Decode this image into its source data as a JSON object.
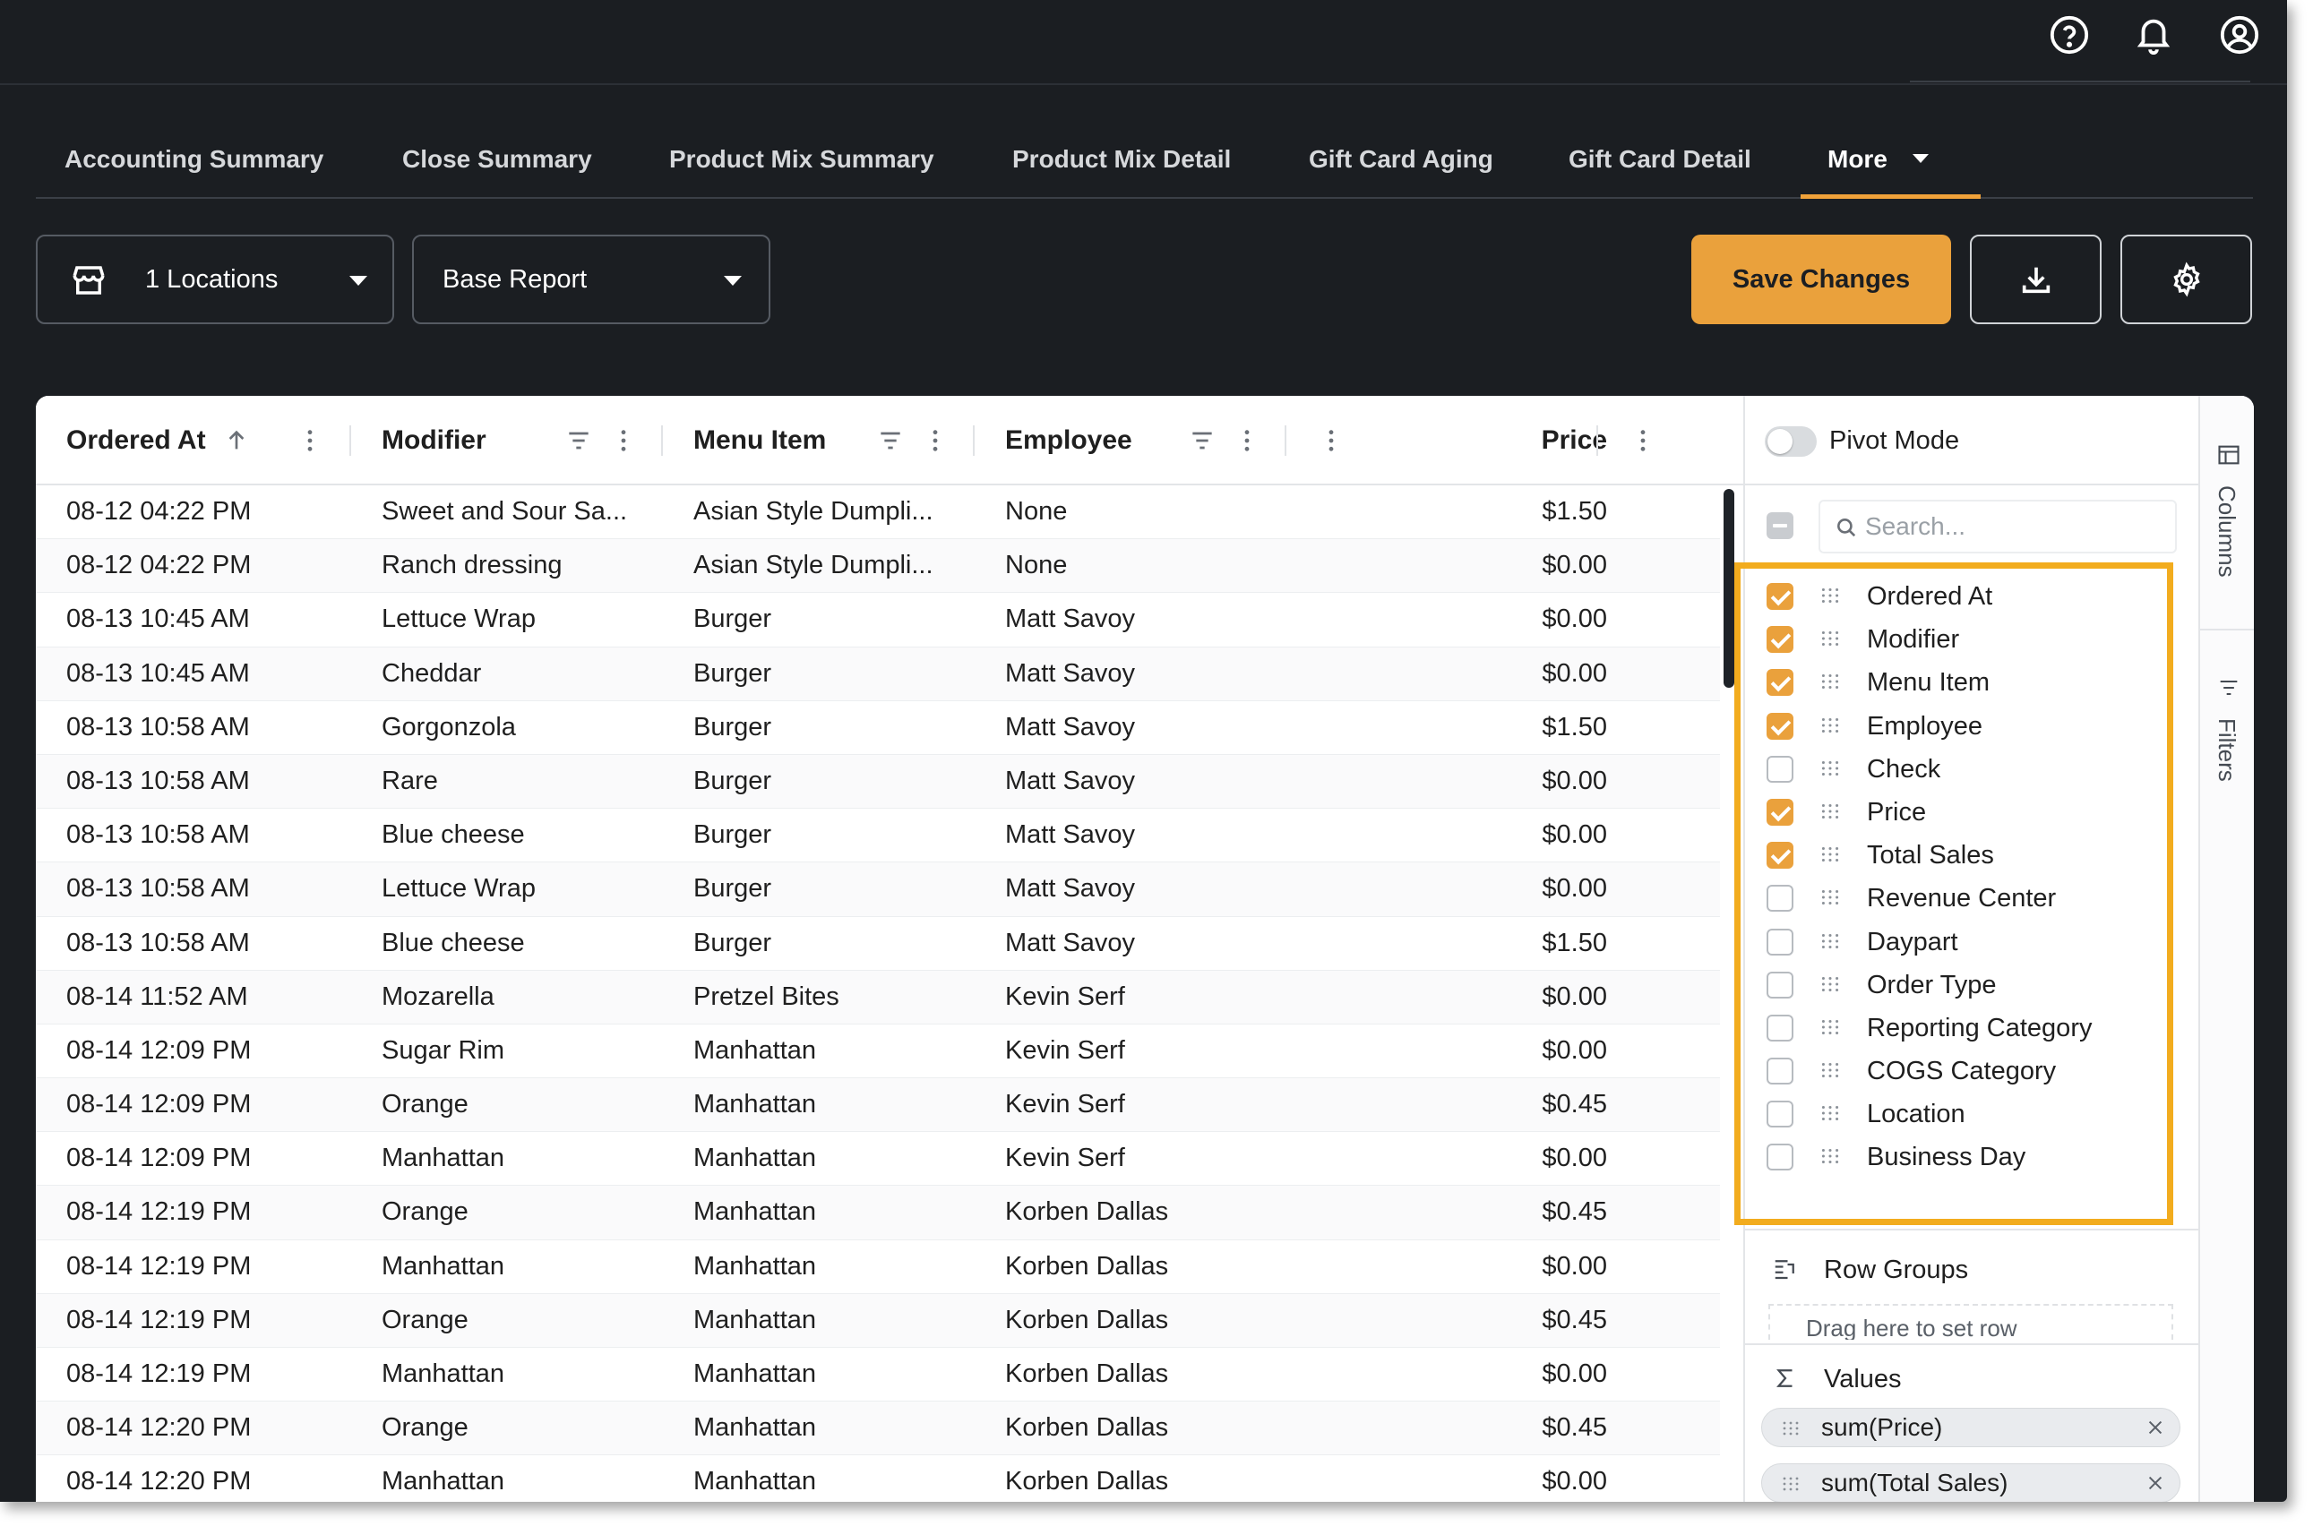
{
  "topbar": {
    "icons": [
      "help-icon",
      "bell-icon",
      "account-icon"
    ]
  },
  "tabs": [
    {
      "label": "Accounting Summary"
    },
    {
      "label": "Close Summary"
    },
    {
      "label": "Product Mix Summary"
    },
    {
      "label": "Product Mix Detail"
    },
    {
      "label": "Gift Card Aging"
    },
    {
      "label": "Gift Card Detail"
    },
    {
      "label": "More",
      "active": true
    }
  ],
  "toolbar": {
    "locations_label": "1 Locations",
    "report_label": "Base Report",
    "save_label": "Save Changes",
    "accent_color": "#eaa13c"
  },
  "grid": {
    "columns": [
      {
        "label": "Ordered At",
        "sort": "ascending"
      },
      {
        "label": "Modifier"
      },
      {
        "label": "Menu Item"
      },
      {
        "label": "Employee"
      },
      {
        "label": ""
      },
      {
        "label": "Price"
      }
    ],
    "rows": [
      [
        "08-12 04:22 PM",
        "Sweet and Sour Sa...",
        "Asian Style Dumpli...",
        "None",
        "$1.50"
      ],
      [
        "08-12 04:22 PM",
        "Ranch dressing",
        "Asian Style Dumpli...",
        "None",
        "$0.00"
      ],
      [
        "08-13 10:45 AM",
        "Lettuce Wrap",
        "Burger",
        "Matt Savoy",
        "$0.00"
      ],
      [
        "08-13 10:45 AM",
        "Cheddar",
        "Burger",
        "Matt Savoy",
        "$0.00"
      ],
      [
        "08-13 10:58 AM",
        "Gorgonzola",
        "Burger",
        "Matt Savoy",
        "$1.50"
      ],
      [
        "08-13 10:58 AM",
        "Rare",
        "Burger",
        "Matt Savoy",
        "$0.00"
      ],
      [
        "08-13 10:58 AM",
        "Blue cheese",
        "Burger",
        "Matt Savoy",
        "$0.00"
      ],
      [
        "08-13 10:58 AM",
        "Lettuce Wrap",
        "Burger",
        "Matt Savoy",
        "$0.00"
      ],
      [
        "08-13 10:58 AM",
        "Blue cheese",
        "Burger",
        "Matt Savoy",
        "$1.50"
      ],
      [
        "08-14 11:52 AM",
        "Mozarella",
        "Pretzel Bites",
        "Kevin Serf",
        "$0.00"
      ],
      [
        "08-14 12:09 PM",
        "Sugar Rim",
        "Manhattan",
        "Kevin Serf",
        "$0.00"
      ],
      [
        "08-14 12:09 PM",
        "Orange",
        "Manhattan",
        "Kevin Serf",
        "$0.45"
      ],
      [
        "08-14 12:09 PM",
        "Manhattan",
        "Manhattan",
        "Kevin Serf",
        "$0.00"
      ],
      [
        "08-14 12:19 PM",
        "Orange",
        "Manhattan",
        "Korben Dallas",
        "$0.45"
      ],
      [
        "08-14 12:19 PM",
        "Manhattan",
        "Manhattan",
        "Korben Dallas",
        "$0.00"
      ],
      [
        "08-14 12:19 PM",
        "Orange",
        "Manhattan",
        "Korben Dallas",
        "$0.45"
      ],
      [
        "08-14 12:19 PM",
        "Manhattan",
        "Manhattan",
        "Korben Dallas",
        "$0.00"
      ],
      [
        "08-14 12:20 PM",
        "Orange",
        "Manhattan",
        "Korben Dallas",
        "$0.45"
      ],
      [
        "08-14 12:20 PM",
        "Manhattan",
        "Manhattan",
        "Korben Dallas",
        "$0.00"
      ]
    ]
  },
  "side_panel": {
    "pivot_label": "Pivot Mode",
    "pivot_on": false,
    "search_placeholder": "Search...",
    "columns": [
      {
        "label": "Ordered At",
        "checked": true
      },
      {
        "label": "Modifier",
        "checked": true
      },
      {
        "label": "Menu Item",
        "checked": true
      },
      {
        "label": "Employee",
        "checked": true
      },
      {
        "label": "Check",
        "checked": false
      },
      {
        "label": "Price",
        "checked": true
      },
      {
        "label": "Total Sales",
        "checked": true
      },
      {
        "label": "Revenue Center",
        "checked": false
      },
      {
        "label": "Daypart",
        "checked": false
      },
      {
        "label": "Order Type",
        "checked": false
      },
      {
        "label": "Reporting Category",
        "checked": false
      },
      {
        "label": "COGS Category",
        "checked": false
      },
      {
        "label": "Location",
        "checked": false
      },
      {
        "label": "Business Day",
        "checked": false
      }
    ],
    "row_groups_label": "Row Groups",
    "row_groups_drop_text": "Drag here to set row",
    "values_label": "Values",
    "values": [
      "sum(Price)",
      "sum(Total Sales)"
    ],
    "tabs": [
      "Columns",
      "Filters"
    ],
    "highlight_color": "#f2ac1e"
  }
}
